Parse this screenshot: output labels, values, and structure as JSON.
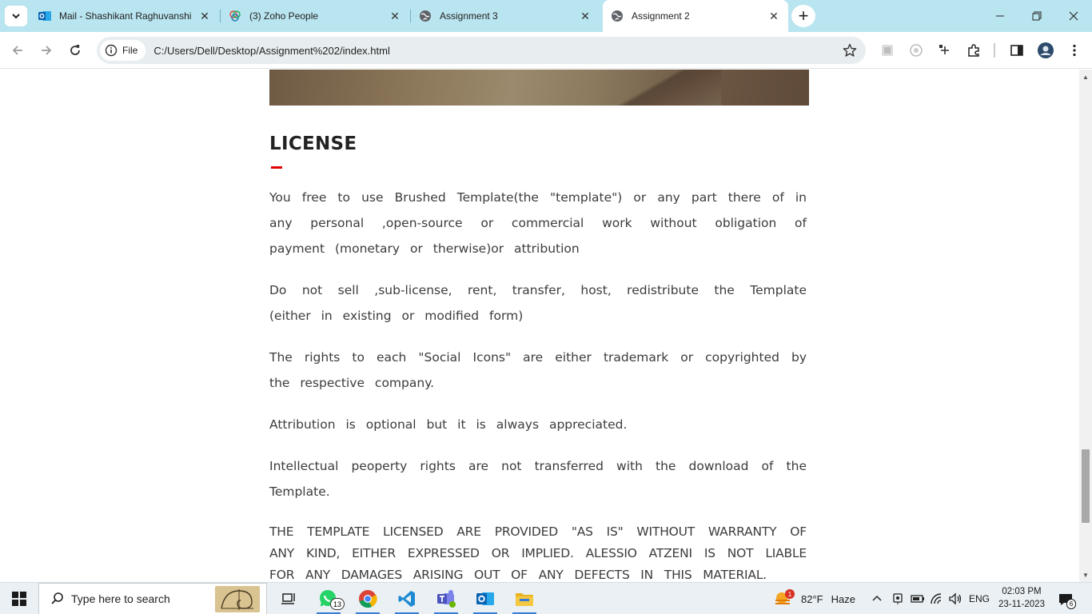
{
  "browser": {
    "tabs": [
      {
        "title": "Mail - Shashikant Raghuvanshi",
        "icon": "outlook-icon"
      },
      {
        "title": "(3) Zoho People",
        "icon": "zoho-icon"
      },
      {
        "title": "Assignment 3",
        "icon": "globe-icon"
      },
      {
        "title": "Assignment 2",
        "icon": "globe-icon",
        "active": true
      }
    ],
    "omnibox": {
      "chip_label": "File",
      "url": "C:/Users/Dell/Desktop/Assignment%202/index.html"
    }
  },
  "page": {
    "heading": "LICENSE",
    "accent_color": "#e00000",
    "paragraphs": [
      "You free to use Brushed Template(the \"template\") or any part there of in any personal ,open-source or commercial work without obligation of payment (monetary or therwise)or attribution",
      "Do not sell ,sub-license, rent, transfer, host, redistribute the Template (either in existing or modified form)",
      "The rights to each \"Social Icons\" are either trademark or copyrighted by the respective company.",
      "Attribution is optional but it is always appreciated.",
      "Intellectual peoperty rights are not transferred with the download of the Template.",
      "THE TEMPLATE LICENSED ARE PROVIDED \"AS IS\" WITHOUT WARRANTY OF ANY KIND, EITHER EXPRESSED OR IMPLIED. ALESSIO ATZENI IS NOT LIABLE FOR ANY DAMAGES ARISING OUT OF ANY DEFECTS IN THIS MATERIAL."
    ]
  },
  "taskbar": {
    "search_placeholder": "Type here to search",
    "whatsapp_badge": "13",
    "weather": {
      "temp": "82°F",
      "condition": "Haze",
      "badge": "1"
    },
    "language": "ENG",
    "time": "02:03 PM",
    "date": "23-11-2023",
    "notification_count": "6"
  }
}
